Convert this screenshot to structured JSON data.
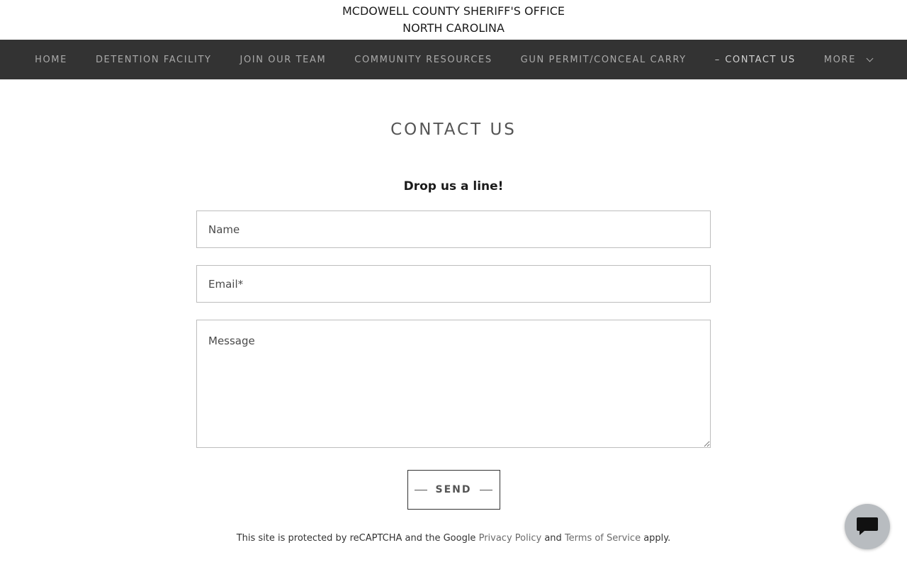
{
  "header": {
    "line1": "MCDOWELL COUNTY SHERIFF'S OFFICE",
    "line2": "NORTH CAROLINA"
  },
  "nav": {
    "items": [
      {
        "label": "HOME"
      },
      {
        "label": "DETENTION FACILITY"
      },
      {
        "label": "JOIN OUR TEAM"
      },
      {
        "label": "COMMUNITY RESOURCES"
      },
      {
        "label": "GUN PERMIT/CONCEAL CARRY"
      },
      {
        "label": "CONTACT US",
        "active_prefix": "–"
      },
      {
        "label": "MORE"
      }
    ]
  },
  "main": {
    "title": "CONTACT US",
    "subtitle": "Drop us a line!",
    "form": {
      "name_placeholder": "Name",
      "email_placeholder": "Email*",
      "message_placeholder": "Message",
      "send_label": "SEND"
    },
    "recaptcha": {
      "prefix": "This site is protected by reCAPTCHA and the Google",
      "privacy_link": "Privacy Policy",
      "and": "and",
      "terms_link": "Terms of Service",
      "suffix": "apply."
    }
  },
  "chat": {
    "icon": "chat-bubble-icon",
    "color": "#b8bcc0"
  },
  "colors": {
    "nav_bg": "#333333",
    "nav_text": "#a9a9a9"
  }
}
